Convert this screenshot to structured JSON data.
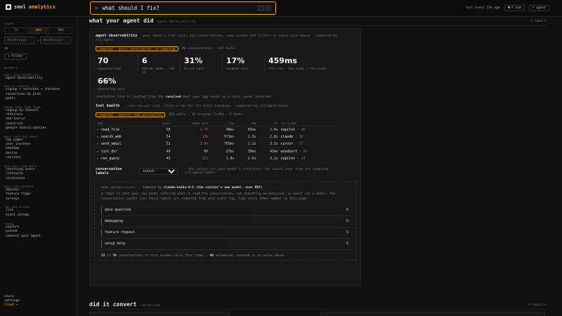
{
  "app": {
    "name": "smol",
    "name_accent": "analytics"
  },
  "ask": {
    "prompt_glyph": ">",
    "placeholder": "what should I fix?",
    "kbd1": "/",
    "kbd2": "⌘"
  },
  "topbar": {
    "last_event": "last event 23h ago",
    "now_label": "2 now",
    "agent_label": "+ agent"
  },
  "sidebar": {
    "scope_label": "scope",
    "ranges": [
      "7d",
      "30d",
      "90d"
    ],
    "active_range": 1,
    "date_from_placeholder": "dd/mm/yyyy",
    "date_to_placeholder": "dd/mm/yyyy",
    "date_arrow": "→",
    "on_label": "on",
    "filter_label": "+ filter",
    "reports_label": "reports",
    "groups": [
      {
        "title": "what your agent did",
        "items": [
          "agent observability"
        ]
      },
      {
        "title": "did it convert",
        "items": [
          "signup → activate → checkout",
          "conversion by plan",
          "goals"
        ]
      },
      {
        "title": "where they came from",
        "items": [
          "signup by channel",
          "referrers",
          "utm source",
          "countries",
          "google search queries"
        ]
      },
      {
        "title": "what they did here",
        "items": [
          "top pages",
          "user journeys",
          "heatmap",
          "device",
          "sessions"
        ]
      },
      {
        "title": "did they come back",
        "items": [
          "returning users",
          "lifecycle",
          "stickiness"
        ]
      },
      {
        "title": "what you shipped",
        "items": [
          "deploys",
          "feature flags",
          "surveys"
        ]
      },
      {
        "title": "the raw record",
        "items": [
          "live",
          "event stream"
        ]
      }
    ],
    "tools_label": "tools",
    "tools_items": [
      "explore",
      "pinned",
      "connect your agent"
    ],
    "footer": [
      "share",
      "settings",
      "Cloud ↗"
    ]
  },
  "section1": {
    "title": "what your agent did",
    "subtitle": "agent observability",
    "report_count": "1 report"
  },
  "obs": {
    "title": "agent observability",
    "desc": "your agent's tool calls and conversations, same window and filters as every tone above · computed by /v1/agent",
    "tag": "computed · every conversation, no sampling",
    "tag_meta": "70 conversations · 419 turns",
    "metrics": [
      {
        "value": "70",
        "label": "conversations"
      },
      {
        "value": "6",
        "label": "median turns · p90 10"
      },
      {
        "value": "31%",
        "label": "re-ask rate"
      },
      {
        "value": "17%",
        "label": "abandon rate"
      },
      {
        "value": "459ms",
        "label": "ttft p50 · p90 643ms | p99 643ms"
      }
    ],
    "metric2": {
      "value": "66%",
      "label": "resolution rate"
    },
    "note_pre": "resolution rate is counted from the",
    "note_bold": "resolved",
    "note_post": "bool your app sends on a turn, never inferred."
  },
  "tool_health": {
    "title": "tool health",
    "desc": "· one row per tool, click a row for its error taxonomy · computed by /v1/agent/tools",
    "tag": "computed · nearest-rank percentiles",
    "tag_meta": "255 calls · 15 errored (5.9%) · 5 tools",
    "headers": [
      "tool",
      "calls",
      "error rate",
      "p50",
      "p90",
      "p99",
      "top client"
    ],
    "rows": [
      {
        "tool": "read_file",
        "calls": "58",
        "error": "1.7%",
        "p50": "48ms",
        "p90": "65ms",
        "p99": "2.0s",
        "client": "copilot",
        "client_n": "· 16",
        "red": true
      },
      {
        "tool": "search_web",
        "calls": "54",
        "error": "13%",
        "p50": "571ms",
        "p90": "2.3s",
        "p99": "2.8s",
        "client": "claude",
        "client_n": "· 16",
        "red": true
      },
      {
        "tool": "send_email",
        "calls": "52",
        "error": "3.8%",
        "p50": "703ms",
        "p90": "1.1s",
        "p99": "3.1s",
        "client": "cursor",
        "client_n": "· 17",
        "red": true
      },
      {
        "tool": "list_dir",
        "calls": "49",
        "error": "0%",
        "p50": "27ms",
        "p90": "30ms",
        "p99": "43ms",
        "client": "windsurf",
        "client_n": "· 16",
        "red": false
      },
      {
        "tool": "run_query",
        "calls": "43",
        "error": "12%",
        "p50": "1.0s",
        "p90": "2.6s",
        "p99": "3.2s",
        "client": "copilot",
        "client_n": "· 14",
        "red": true
      }
    ]
  },
  "labels": {
    "title": "conversation labels",
    "select_value": "intent",
    "desc": "· the values are your model's inference, the counts over them are computed · /v1/agent/labels",
    "inner_tag": "model-inferred values",
    "inner_labeled": "labeled by",
    "inner_model": "claude-haiku-4-5 (the visitor's own model, over MCP)",
    "inner_desc": "a label is what your own model inferred when it read the conversation, not something we measured. we never run a model. the conversation counts over those labels are computed from your event log, like every other number on this page.",
    "bars": [
      {
        "name": "data question",
        "count": "6",
        "share": 0.6
      },
      {
        "name": "debugging",
        "count": "6",
        "share": 0.6
      },
      {
        "name": "feature request",
        "count": "5",
        "share": 0.5
      },
      {
        "name": "setup help",
        "count": "5",
        "share": 0.5
      }
    ],
    "foot_a": "22",
    "foot_of": "of",
    "foot_b": "70",
    "foot_mid": "conversations in this window carry this label ·",
    "foot_c": "48",
    "foot_end": "unlabeled, counted in no value above"
  },
  "section2": {
    "title": "did it convert",
    "subtitle": "conversion",
    "report_count": "3 reports"
  }
}
